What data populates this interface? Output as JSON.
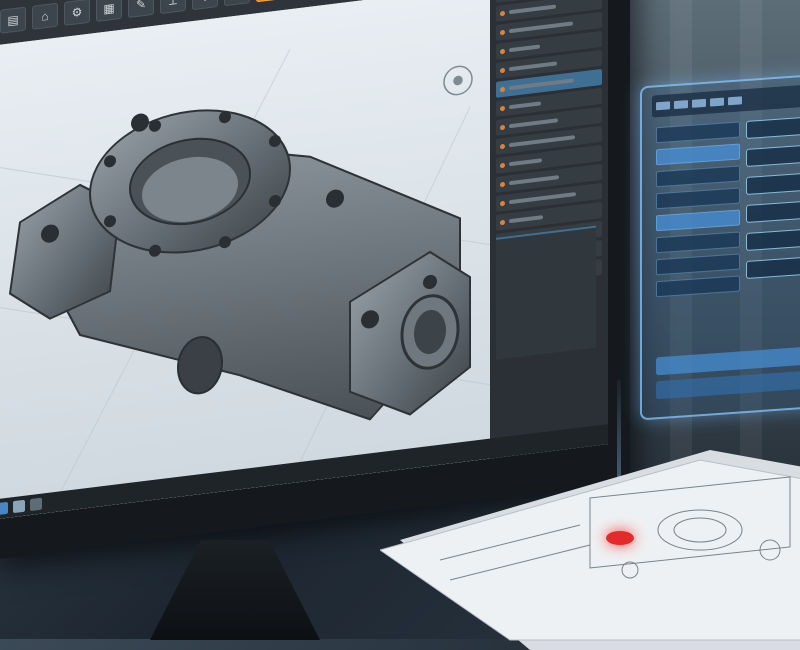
{
  "scene": {
    "description_hidden": ""
  },
  "toolbar": {
    "buttons": [
      {
        "name": "file-icon",
        "glyph": "▤"
      },
      {
        "name": "open-icon",
        "glyph": "⌂"
      },
      {
        "name": "settings-icon",
        "glyph": "⚙"
      },
      {
        "name": "grid-icon",
        "glyph": "▦"
      },
      {
        "name": "sketch-icon",
        "glyph": "✎"
      },
      {
        "name": "measure-icon",
        "glyph": "⟂"
      },
      {
        "name": "move-icon",
        "glyph": "✥"
      },
      {
        "name": "layers-icon",
        "glyph": "▧"
      },
      {
        "name": "shape-icon",
        "glyph": "⬢",
        "highlight": true
      },
      {
        "name": "view-icon",
        "glyph": "◎"
      },
      {
        "name": "render-icon",
        "glyph": "▣"
      }
    ]
  },
  "colors": {
    "accent": "#e38b2c",
    "selection": "#3f6f93",
    "laser": "#e42a2a",
    "hologram": "#8cc8ff"
  }
}
